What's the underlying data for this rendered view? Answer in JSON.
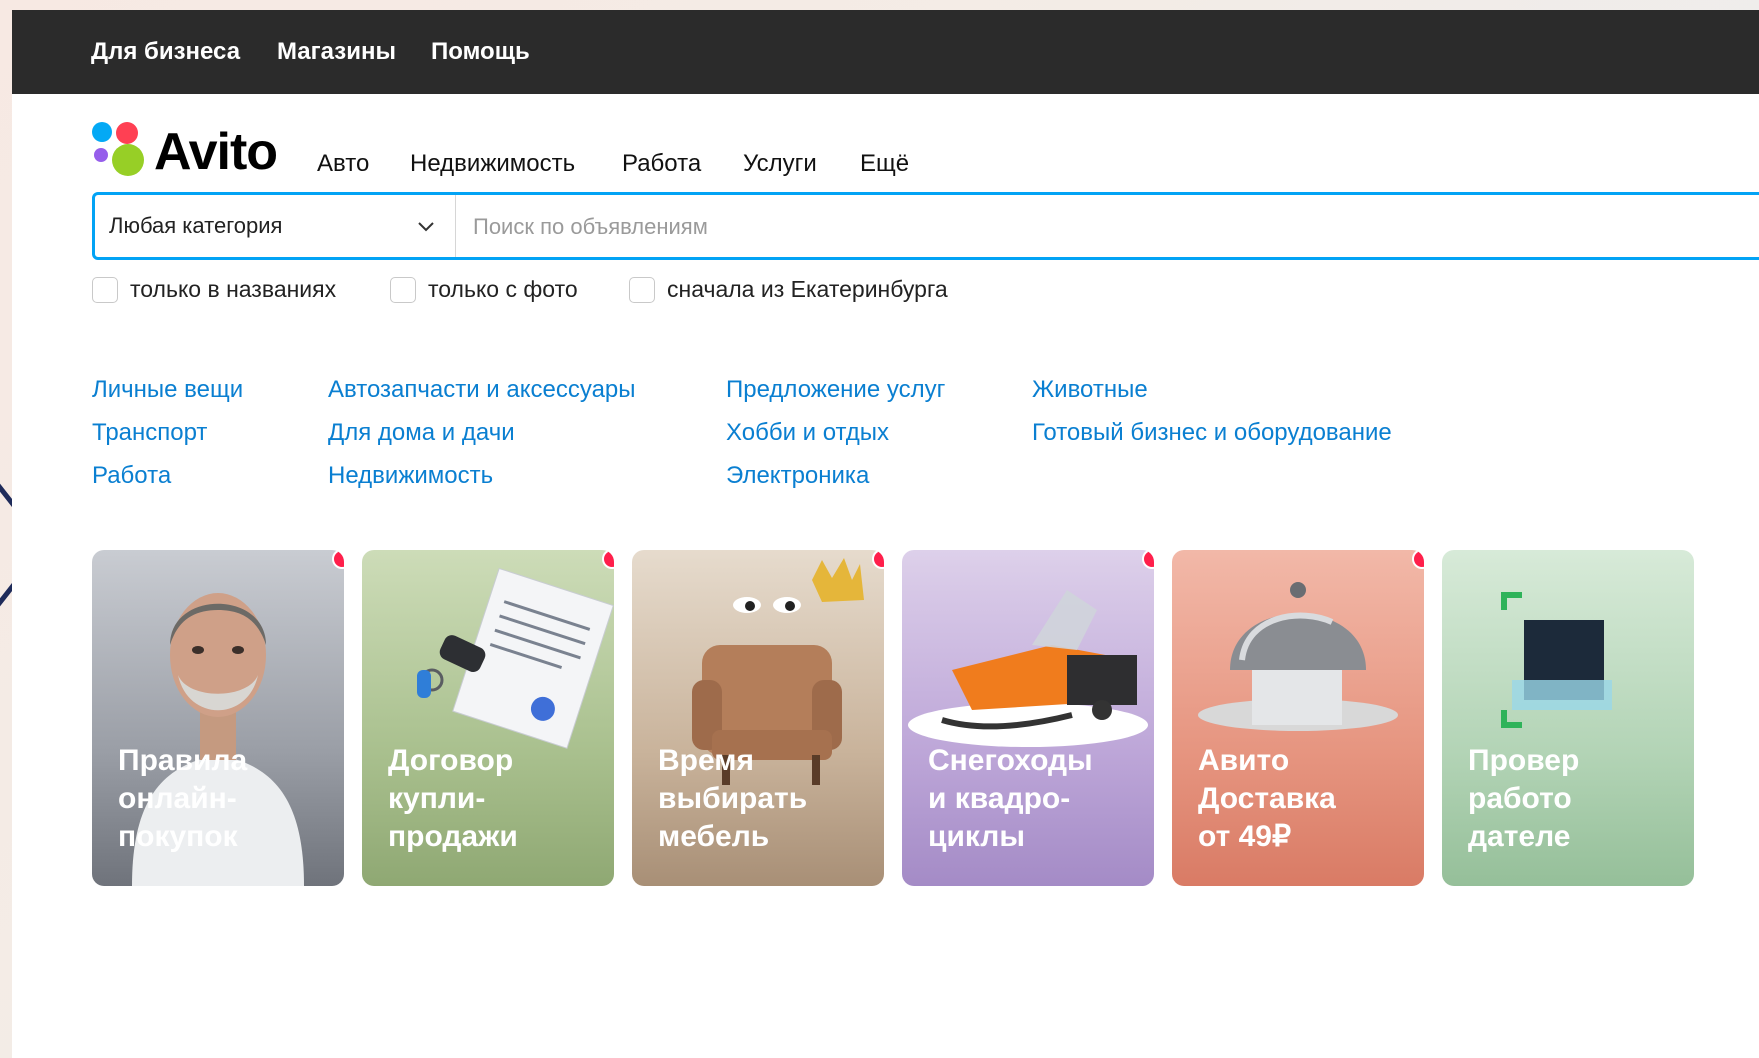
{
  "topbar": {
    "links": [
      "Для бизнеса",
      "Магазины",
      "Помощь"
    ]
  },
  "header": {
    "logo_text": "Avito",
    "nav": [
      "Авто",
      "Недвижимость",
      "Работа",
      "Услуги",
      "Ещё"
    ]
  },
  "search": {
    "category_label": "Любая категория",
    "placeholder": "Поиск по объявлениям"
  },
  "filters": {
    "only_titles": "только в названиях",
    "only_photo": "только с фото",
    "city_first": "сначала из Екатеринбурга"
  },
  "categories": {
    "col1": [
      "Личные вещи",
      "Транспорт",
      "Работа"
    ],
    "col2": [
      "Автозапчасти и аксессуары",
      "Для дома и дачи",
      "Недвижимость"
    ],
    "col3": [
      "Предложение услуг",
      "Хобби и отдых",
      "Электроника"
    ],
    "col4": [
      "Животные",
      "Готовый бизнес и оборудование"
    ]
  },
  "cards": [
    {
      "title": "Правила\nонлайн-\nпокупок"
    },
    {
      "title": "Договор\nкупли-\nпродажи"
    },
    {
      "title": "Время\nвыбирать\nмебель"
    },
    {
      "title": "Снегоходы\nи квадро-\nциклы"
    },
    {
      "title": "Авито\nДоставка\nот 49₽"
    },
    {
      "title": "Провер\nработо\nдателе"
    }
  ],
  "colors": {
    "topbar_bg": "#2b2b2b",
    "link_blue": "#0a7fd1",
    "search_border": "#02a3f5",
    "badge_red": "#ff1f4b"
  }
}
